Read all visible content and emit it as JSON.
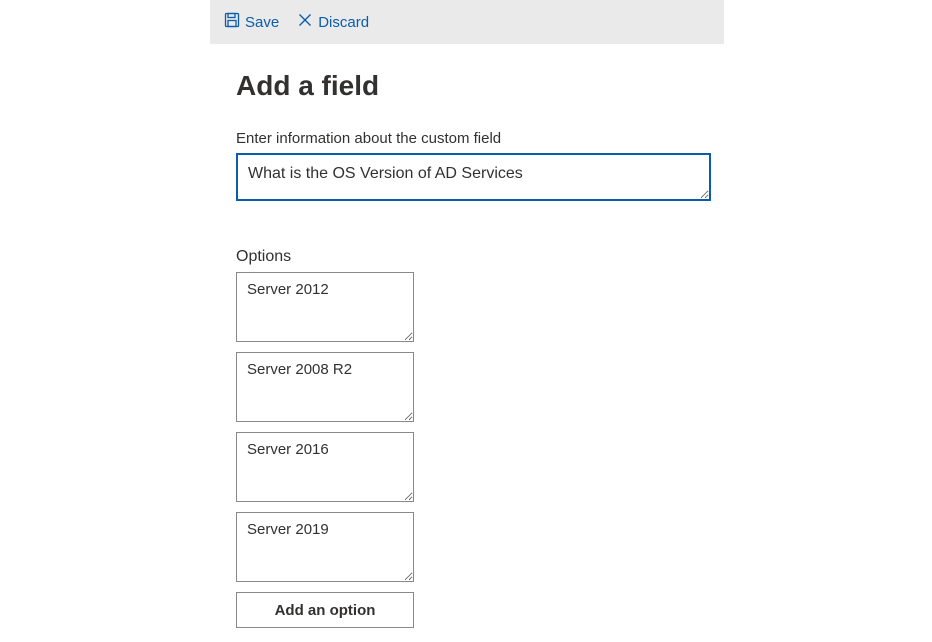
{
  "toolbar": {
    "save_label": "Save",
    "discard_label": "Discard"
  },
  "page": {
    "title": "Add a field",
    "field_label": "Enter information about the custom field",
    "field_value": "What is the OS Version of AD Services"
  },
  "options": {
    "label": "Options",
    "items": [
      "Server 2012",
      "Server 2008 R2",
      "Server 2016",
      "Server 2019"
    ],
    "add_button_label": "Add an option"
  }
}
